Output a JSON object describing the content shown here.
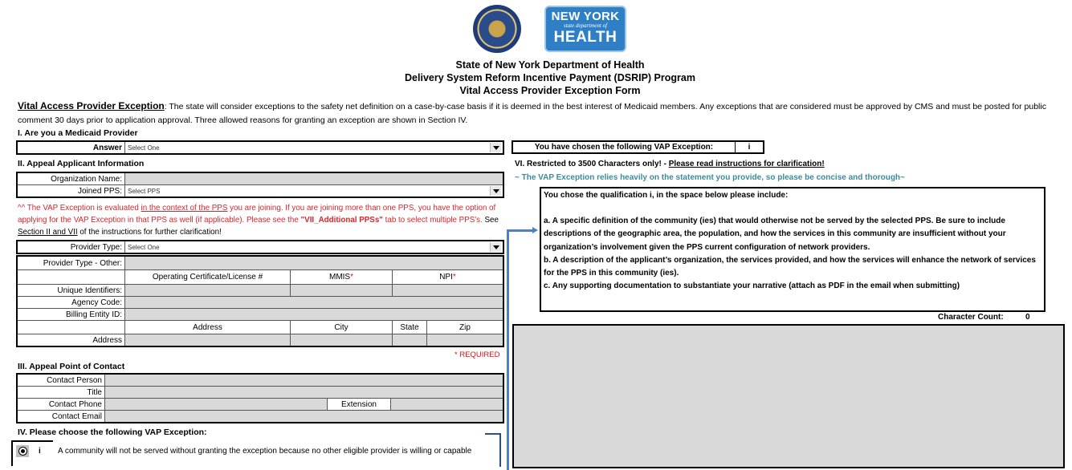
{
  "header": {
    "logos": {
      "seal": "new-york-state-seal",
      "doh_line1": "NEW YORK",
      "doh_line2": "state department of",
      "doh_line3": "HEALTH"
    },
    "title_lines": [
      "State of New York Department of Health",
      "Delivery System Reform Incentive Payment (DSRIP) Program",
      "Vital Access Provider Exception Form"
    ]
  },
  "intro": {
    "lead": "Vital Access Provider Exception",
    "text": ": The state will consider exceptions to the safety net definition on a case-by-case basis if it is deemed in the best interest of Medicaid members. Any exceptions that are considered must be approved by CMS and must be posted for public comment 30 days prior to application approval. Three allowed reasons for granting an exception are shown in Section IV."
  },
  "section1": {
    "title": "I. Are you a Medicaid Provider",
    "answer_label": "Answer",
    "answer_value": "Select One"
  },
  "section2": {
    "title": "II. Appeal Applicant Information",
    "org_name_label": "Organization Name:",
    "org_name_value": "",
    "joined_pps_label": "Joined PPS:",
    "joined_pps_value": "Select PPS",
    "note_prefix": "^^ The VAP Exception is evaluated ",
    "note_underlined": "in the context of the PPS",
    "note_middle": " you are joining. If you are joining more than one PPS, you have the option of applying for the  VAP Exception in that PPS as well (if applicable). Please see the ",
    "note_bold": "\"VII_Additional PPSs\"",
    "note_after_bold": " tab to select multiple PPS's. ",
    "note_see": "See ",
    "note_section_link": "Section II and VII",
    "note_end": " of the instructions for further clarification!",
    "provider_type_label": "Provider Type:",
    "provider_type_value": "Select One",
    "provider_type_other_label": "Provider Type - Other:",
    "id_headers": [
      "Operating Certificate/License #",
      "MMIS",
      "NPI"
    ],
    "required_mark": "*",
    "unique_identifiers_label": "Unique Identifiers:",
    "agency_code_label": "Agency Code:",
    "billing_entity_label": "Billing Entity ID:",
    "address_headers": [
      "Address",
      "City",
      "State",
      "Zip"
    ],
    "address_label": "Address",
    "required_note": "* REQUIRED"
  },
  "section3": {
    "title": "III. Appeal Point of Contact",
    "contact_person_label": "Contact Person",
    "title_label": "Title",
    "contact_phone_label": "Contact Phone",
    "extension_label": "Extension",
    "contact_email_label": "Contact Email"
  },
  "section4": {
    "title": "IV. Please choose the following VAP Exception:",
    "options": [
      {
        "numeral": "i",
        "selected": true,
        "text": "A community will not be served without granting the exception because no other eligible provider is willing or capable"
      }
    ]
  },
  "chosen_exception": {
    "label": "You have chosen the following VAP Exception:",
    "value": "i"
  },
  "section6": {
    "title": "VI. Restricted to 3500 Characters only! - ",
    "title_link": "Please read instructions for clarification!",
    "subtitle": "~ The VAP Exception relies heavily on the statement you provide, so please be concise and thorough~",
    "instructions": {
      "intro": "You chose the qualification i, in the space below please include:",
      "a": "a. A specific definition of the community (ies) that would otherwise not be served by the selected PPS. Be sure to include descriptions of the geographic area, the population, and how the services in this community are insufficient without your organization’s involvement given the PPS current configuration of network providers.",
      "b": "b. A description of the applicant’s organization, the services provided, and how the services will enhance the network of services for the PPS in this community (ies).",
      "c": "c. Any supporting documentation to substantiate your narrative (attach as PDF in the email when submitting)"
    },
    "char_count_label": "Character Count:",
    "char_count_value": "0",
    "statement_value": ""
  },
  "colors": {
    "input_fill": "#d9d9d9",
    "required_red": "#d6262b",
    "teal_note": "#3d8a9b",
    "arrow_blue": "#4f81bd",
    "logo_blue": "#2f7fc6"
  }
}
